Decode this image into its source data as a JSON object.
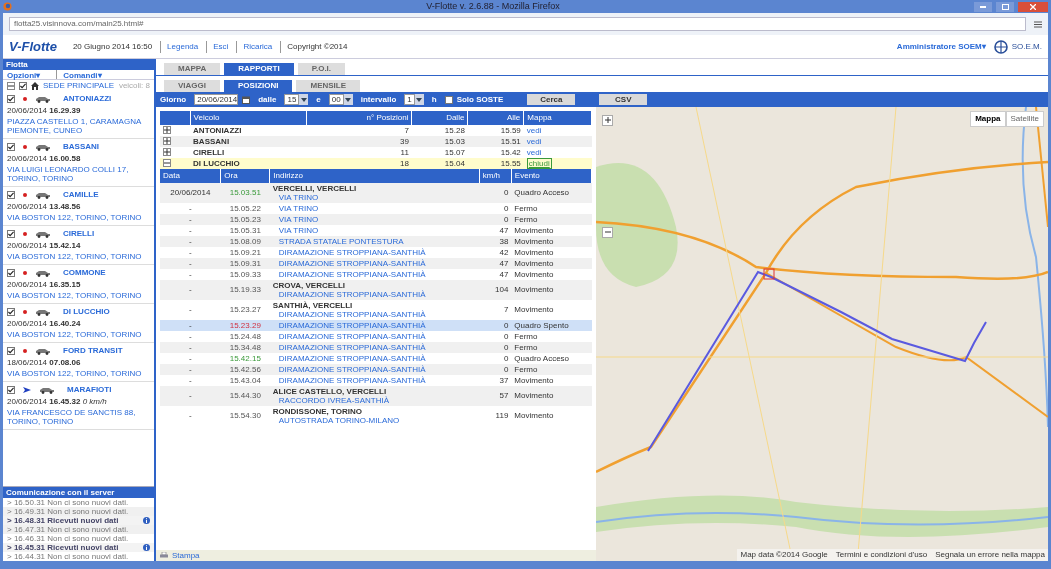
{
  "window": {
    "title": "V-Flotte v. 2.6.88 - Mozilla Firefox",
    "url": "flotta25.visinnova.com/main25.html#"
  },
  "header": {
    "logo": "V-Flotte",
    "date_time": "20 Giugno 2014 16:50",
    "links": [
      "Legenda",
      "Esci",
      "Ricarica"
    ],
    "copyright": "Copyright ©2014",
    "user": "Amministratore SOEM▾",
    "company_logo": "SO.E.M."
  },
  "sidebar": {
    "title": "Flotta",
    "menus": [
      "Opzioni▾",
      "Comandi▾"
    ],
    "group": {
      "label": "SEDE PRINCIPALE",
      "checked": true,
      "count": "veicoli: 8"
    },
    "vehicles": [
      {
        "name": "ANTONIAZZI",
        "checked": true,
        "kind": "stopped",
        "datetime": "20/06/2014 **16.29.39**",
        "address": "PIAZZA CASTELLO 1, CARAMAGNA PIEMONTE, CUNEO"
      },
      {
        "name": "BASSANI",
        "checked": true,
        "kind": "stopped",
        "datetime": "20/06/2014 **16.00.58**",
        "address": "VIA LUIGI LEONARDO COLLI 17, TORINO, TORINO"
      },
      {
        "name": "CAMILLE",
        "checked": true,
        "kind": "stopped",
        "datetime": "20/06/2014 **13.48.56**",
        "address": "VIA BOSTON 122, TORINO, TORINO"
      },
      {
        "name": "CIRELLI",
        "checked": true,
        "kind": "stopped",
        "datetime": "20/06/2014 **15.42.14**",
        "address": "VIA BOSTON 122, TORINO, TORINO"
      },
      {
        "name": "COMMONE",
        "checked": true,
        "kind": "stopped",
        "datetime": "20/06/2014 **16.35.15**",
        "address": "VIA BOSTON 122, TORINO, TORINO"
      },
      {
        "name": "DI LUCCHIO",
        "checked": true,
        "kind": "stopped",
        "datetime": "20/06/2014 **16.40.24**",
        "address": "VIA BOSTON 122, TORINO, TORINO"
      },
      {
        "name": "FORD TRANSIT",
        "checked": true,
        "kind": "stopped",
        "datetime": "18/06/2014 **07.08.06**",
        "address": "VIA BOSTON 122, TORINO, TORINO"
      },
      {
        "name": "MARAFIOTI",
        "checked": true,
        "kind": "moving",
        "datetime": "20/06/2014 **16.45.32** *0 km/h*",
        "address": "VIA FRANCESCO DE SANCTIS 88, TORINO, TORINO"
      }
    ],
    "comms": {
      "title": "Comunicazione con il server",
      "entries": [
        {
          "text": "> 16.50.31 Non ci sono nuovi dati.",
          "kind": "empty"
        },
        {
          "text": "> 16.49.31 Non ci sono nuovi dati.",
          "kind": "empty"
        },
        {
          "text": "> 16.48.31 Ricevuti nuovi dati",
          "kind": "received"
        },
        {
          "text": "> 16.47.31 Non ci sono nuovi dati.",
          "kind": "empty"
        },
        {
          "text": "> 16.46.31 Non ci sono nuovi dati.",
          "kind": "empty"
        },
        {
          "text": "> 16.45.31 Ricevuti nuovi dati",
          "kind": "received"
        },
        {
          "text": "> 16.44.31 Non ci sono nuovi dati.",
          "kind": "empty"
        }
      ]
    }
  },
  "tabs": [
    {
      "label": "MAPPA",
      "selected": false
    },
    {
      "label": "RAPPORTI",
      "selected": true
    },
    {
      "label": "P.O.I.",
      "selected": false
    }
  ],
  "subtabs": [
    {
      "label": "VIAGGI",
      "selected": false
    },
    {
      "label": "POSIZIONI",
      "selected": true
    },
    {
      "label": "MENSILE",
      "selected": false
    }
  ],
  "filter": {
    "day_label": "Giorno",
    "date": "20/06/2014",
    "from_label": "dalle",
    "hour": "15",
    "and_label": "e",
    "minute": "00",
    "interval_label": "intervallo",
    "interval": "1",
    "unit": "h",
    "only_stops": {
      "label": "Solo SOSTE",
      "checked": false
    },
    "buttons": [
      "Cerca",
      "CSV"
    ]
  },
  "summary": {
    "columns": [
      "Veicolo",
      "n° Posizioni",
      "Dalle",
      "Alle",
      "Mappa"
    ],
    "rows": [
      {
        "expanded": false,
        "selected": false,
        "vehicle": "ANTONIAZZI",
        "count": "7",
        "from": "15.28",
        "to": "15.59",
        "link": "vedi"
      },
      {
        "expanded": false,
        "selected": false,
        "vehicle": "BASSANI",
        "count": "39",
        "from": "15.03",
        "to": "15.51",
        "link": "vedi"
      },
      {
        "expanded": false,
        "selected": false,
        "vehicle": "CIRELLI",
        "count": "11",
        "from": "15.07",
        "to": "15.42",
        "link": "vedi"
      },
      {
        "expanded": true,
        "selected": true,
        "vehicle": "DI LUCCHIO",
        "count": "18",
        "from": "15.04",
        "to": "15.55",
        "link": "chiudi"
      }
    ]
  },
  "positions": {
    "columns": [
      "Data",
      "Ora",
      "Indirizzo",
      "km/h",
      "Evento"
    ],
    "rows": [
      {
        "date": "20/06/2014",
        "time": "15.03.51",
        "kind": "ignition_on",
        "place": "VERCELLI, VERCELLI",
        "road": "VIA TRINO",
        "speed": "0",
        "event": "Quadro Acceso",
        "selected": false
      },
      {
        "date": "-",
        "time": "15.05.22",
        "kind": "normal",
        "road": "VIA TRINO",
        "speed": "0",
        "event": "Fermo",
        "selected": false
      },
      {
        "date": "-",
        "time": "15.05.23",
        "kind": "normal",
        "road": "VIA TRINO",
        "speed": "0",
        "event": "Fermo",
        "selected": false
      },
      {
        "date": "-",
        "time": "15.05.31",
        "kind": "normal",
        "road": "VIA TRINO",
        "speed": "47",
        "event": "Movimento",
        "selected": false
      },
      {
        "date": "-",
        "time": "15.08.09",
        "kind": "normal",
        "road": "STRADA STATALE PONTESTURA",
        "speed": "38",
        "event": "Movimento",
        "selected": false
      },
      {
        "date": "-",
        "time": "15.09.21",
        "kind": "normal",
        "road": "DIRAMAZIONE STROPPIANA-SANTHIÀ",
        "speed": "42",
        "event": "Movimento",
        "selected": false
      },
      {
        "date": "-",
        "time": "15.09.31",
        "kind": "normal",
        "road": "DIRAMAZIONE STROPPIANA-SANTHIÀ",
        "speed": "47",
        "event": "Movimento",
        "selected": false
      },
      {
        "date": "-",
        "time": "15.09.33",
        "kind": "normal",
        "road": "DIRAMAZIONE STROPPIANA-SANTHIÀ",
        "speed": "47",
        "event": "Movimento",
        "selected": false
      },
      {
        "date": "-",
        "time": "15.19.33",
        "kind": "normal",
        "place": "CROVA, VERCELLI",
        "road": "DIRAMAZIONE STROPPIANA-SANTHIÀ",
        "speed": "104",
        "event": "Movimento",
        "selected": false
      },
      {
        "date": "-",
        "time": "15.23.27",
        "kind": "normal",
        "place": "SANTHIÀ, VERCELLI",
        "road": "DIRAMAZIONE STROPPIANA-SANTHIÀ",
        "speed": "7",
        "event": "Movimento",
        "selected": false
      },
      {
        "date": "-",
        "time": "15.23.29",
        "kind": "ignition_off",
        "road": "DIRAMAZIONE STROPPIANA-SANTHIÀ",
        "speed": "0",
        "event": "Quadro Spento",
        "selected": true
      },
      {
        "date": "-",
        "time": "15.24.48",
        "kind": "normal",
        "road": "DIRAMAZIONE STROPPIANA-SANTHIÀ",
        "speed": "0",
        "event": "Fermo",
        "selected": false
      },
      {
        "date": "-",
        "time": "15.34.48",
        "kind": "normal",
        "road": "DIRAMAZIONE STROPPIANA-SANTHIÀ",
        "speed": "0",
        "event": "Fermo",
        "selected": false
      },
      {
        "date": "-",
        "time": "15.42.15",
        "kind": "ignition_on",
        "road": "DIRAMAZIONE STROPPIANA-SANTHIÀ",
        "speed": "0",
        "event": "Quadro Acceso",
        "selected": false
      },
      {
        "date": "-",
        "time": "15.42.56",
        "kind": "normal",
        "road": "DIRAMAZIONE STROPPIANA-SANTHIÀ",
        "speed": "0",
        "event": "Fermo",
        "selected": false
      },
      {
        "date": "-",
        "time": "15.43.04",
        "kind": "normal",
        "road": "DIRAMAZIONE STROPPIANA-SANTHIÀ",
        "speed": "37",
        "event": "Movimento",
        "selected": false
      },
      {
        "date": "-",
        "time": "15.44.30",
        "kind": "normal",
        "place": "ALICE CASTELLO, VERCELLI",
        "road": "RACCORDO IVREA-SANTHIÀ",
        "speed": "57",
        "event": "Movimento",
        "selected": false
      },
      {
        "date": "-",
        "time": "15.54.30",
        "kind": "normal",
        "place": "RONDISSONE, TORINO",
        "road": "AUTOSTRADA TORINO-MILANO",
        "speed": "119",
        "event": "Movimento",
        "selected": false
      }
    ]
  },
  "print_label": "Stampa",
  "map": {
    "types": [
      {
        "label": "Mappa",
        "selected": true
      },
      {
        "label": "Satellite",
        "selected": false
      }
    ],
    "footer": [
      "Map data ©2014 Google",
      "Termini e condizioni d'uso",
      "Segnala un errore nella mappa"
    ]
  }
}
